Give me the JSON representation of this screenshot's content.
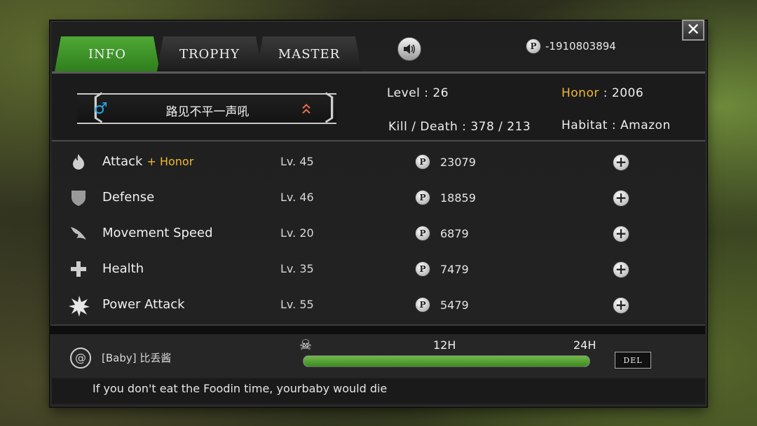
{
  "tabs": [
    {
      "label": "INFO",
      "active": true
    },
    {
      "label": "TROPHY",
      "active": false
    },
    {
      "label": "MASTER",
      "active": false
    }
  ],
  "points": {
    "icon": "P",
    "value": "-1910803894"
  },
  "close": {
    "label": "✕"
  },
  "profile": {
    "gender_icon": "♂",
    "nickname": "路见不平一声吼",
    "level_label": "Level",
    "level": "26",
    "honor_label": "Honor",
    "honor": "2006",
    "kd_label": "Kill / Death",
    "kd": "378  /  213",
    "habitat_label": "Habitat",
    "habitat": "Amazon"
  },
  "stats": [
    {
      "name": "Attack",
      "bonus": "+ Honor",
      "level": "Lv. 45",
      "cost": "23079",
      "icon": "flame-icon"
    },
    {
      "name": "Defense",
      "bonus": "",
      "level": "Lv. 46",
      "cost": "18859",
      "icon": "shield-icon"
    },
    {
      "name": "Movement Speed",
      "bonus": "",
      "level": "Lv. 20",
      "cost": "6879",
      "icon": "wing-icon"
    },
    {
      "name": "Health",
      "bonus": "",
      "level": "Lv. 35",
      "cost": "7479",
      "icon": "cross-icon"
    },
    {
      "name": "Power Attack",
      "bonus": "",
      "level": "Lv. 55",
      "cost": "5479",
      "icon": "burst-icon"
    }
  ],
  "baby": {
    "name": "[Baby] 比丢酱",
    "marker_12": "12H",
    "marker_24": "24H",
    "timer_fraction": 1.0,
    "del_label": "DEL"
  },
  "tip": "If you don't eat the Foodin time, yourbaby would die",
  "colors": {
    "tab_active": "#3f9a2a",
    "gold": "#f1b931",
    "gender": "#29a7e6",
    "timer": "#4c9a2e"
  }
}
